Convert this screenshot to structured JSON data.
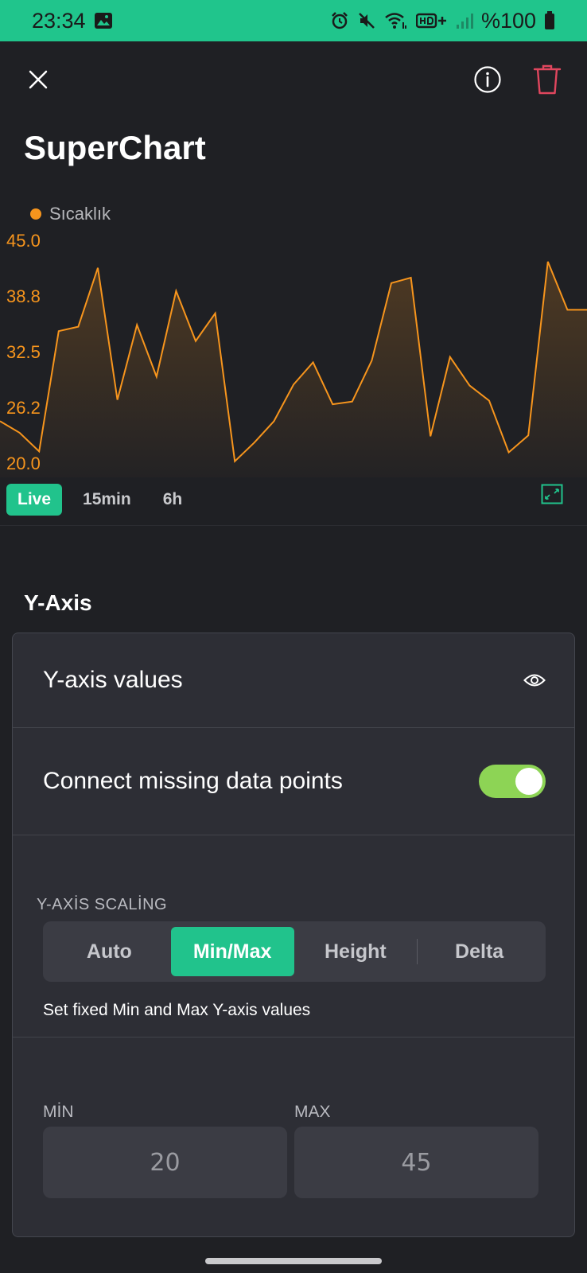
{
  "status_bar": {
    "time": "23:34",
    "battery": "%100",
    "background": "#20c58c"
  },
  "toolbar": {
    "close_icon": "close-icon",
    "info_icon": "info-icon",
    "delete_icon": "trash-icon",
    "delete_color": "#e0465e"
  },
  "page": {
    "title": "SuperChart"
  },
  "chart_data": {
    "type": "area",
    "legend": [
      {
        "name": "Sıcaklık",
        "color": "#f7951d"
      }
    ],
    "y_ticks": [
      "45.0",
      "38.8",
      "32.5",
      "26.2",
      "20.0"
    ],
    "ylim": [
      20,
      45
    ],
    "grid": false,
    "series": [
      {
        "name": "Sıcaklık",
        "color": "#f7951d",
        "values": [
          24.7,
          23.4,
          21.3,
          34.8,
          35.3,
          41.9,
          27.1,
          35.5,
          29.7,
          39.3,
          33.7,
          36.8,
          20.2,
          22.3,
          24.7,
          28.8,
          31.3,
          26.6,
          26.9,
          31.5,
          40.2,
          40.8,
          23.0,
          31.9,
          28.7,
          27.0,
          21.2,
          23.1,
          42.6,
          37.2,
          37.2
        ]
      }
    ]
  },
  "range_tabs": [
    {
      "label": "Live",
      "active": true
    },
    {
      "label": "15min",
      "active": false
    },
    {
      "label": "6h",
      "active": false
    }
  ],
  "fullscreen_icon": "expand-icon",
  "y_axis": {
    "section_title": "Y-Axis",
    "values_label": "Y-axis values",
    "values_icon": "eye-icon",
    "connect_label": "Connect missing data points",
    "connect_enabled": true,
    "toggle_color": "#8dd455",
    "scaling_label": "Y-AXİS SCALİNG",
    "scaling_options": [
      {
        "label": "Auto",
        "active": false
      },
      {
        "label": "Min/Max",
        "active": true
      },
      {
        "label": "Height",
        "active": false
      },
      {
        "label": "Delta",
        "active": false
      }
    ],
    "scaling_description": "Set fixed Min and Max Y-axis values",
    "min_label": "MİN",
    "min_value": "20",
    "max_label": "MAX",
    "max_value": "45"
  },
  "accent_color": "#21c38c"
}
